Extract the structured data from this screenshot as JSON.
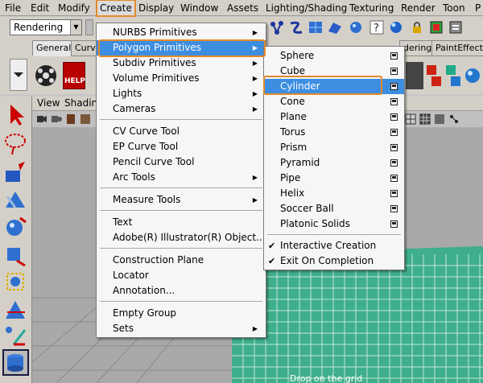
{
  "menubar": {
    "items": [
      "File",
      "Edit",
      "Modify",
      "Create",
      "Display",
      "Window",
      "Assets",
      "Lighting/Shading",
      "Texturing",
      "Render",
      "Toon",
      "P"
    ]
  },
  "status": {
    "mode_value": "Rendering"
  },
  "shelf": {
    "tabs": [
      "General",
      "Curve",
      "dering",
      "PaintEffects"
    ],
    "help_label": "HELP"
  },
  "viewport": {
    "menu": [
      "View",
      "Shadin"
    ],
    "hint_text": "Drop on the grid"
  },
  "create_menu": {
    "items": [
      {
        "label": "NURBS Primitives",
        "submenu": true
      },
      {
        "label": "Polygon Primitives",
        "submenu": true,
        "highlighted": true
      },
      {
        "label": "Subdiv Primitives",
        "submenu": true
      },
      {
        "label": "Volume Primitives",
        "submenu": true
      },
      {
        "label": "Lights",
        "submenu": true
      },
      {
        "label": "Cameras",
        "submenu": true
      },
      {
        "label": "CV Curve Tool"
      },
      {
        "label": "EP Curve Tool"
      },
      {
        "label": "Pencil Curve Tool"
      },
      {
        "label": "Arc Tools",
        "submenu": true
      },
      {
        "label": "Measure Tools",
        "submenu": true
      },
      {
        "label": "Text"
      },
      {
        "label": "Adobe(R) Illustrator(R) Object..."
      },
      {
        "label": "Construction Plane"
      },
      {
        "label": "Locator"
      },
      {
        "label": "Annotation..."
      },
      {
        "label": "Empty Group"
      },
      {
        "label": "Sets",
        "submenu": true
      }
    ]
  },
  "poly_menu": {
    "items": [
      {
        "label": "Sphere"
      },
      {
        "label": "Cube"
      },
      {
        "label": "Cylinder",
        "highlighted": true
      },
      {
        "label": "Cone"
      },
      {
        "label": "Plane"
      },
      {
        "label": "Torus"
      },
      {
        "label": "Prism"
      },
      {
        "label": "Pyramid"
      },
      {
        "label": "Pipe"
      },
      {
        "label": "Helix"
      },
      {
        "label": "Soccer Ball"
      },
      {
        "label": "Platonic Solids"
      }
    ],
    "checks": [
      {
        "label": "Interactive Creation",
        "checked": true
      },
      {
        "label": "Exit On Completion",
        "checked": true
      }
    ]
  },
  "colors": {
    "highlight": "#3d8ee0",
    "annotation": "#e5892a",
    "grid": "#3fae8c"
  }
}
